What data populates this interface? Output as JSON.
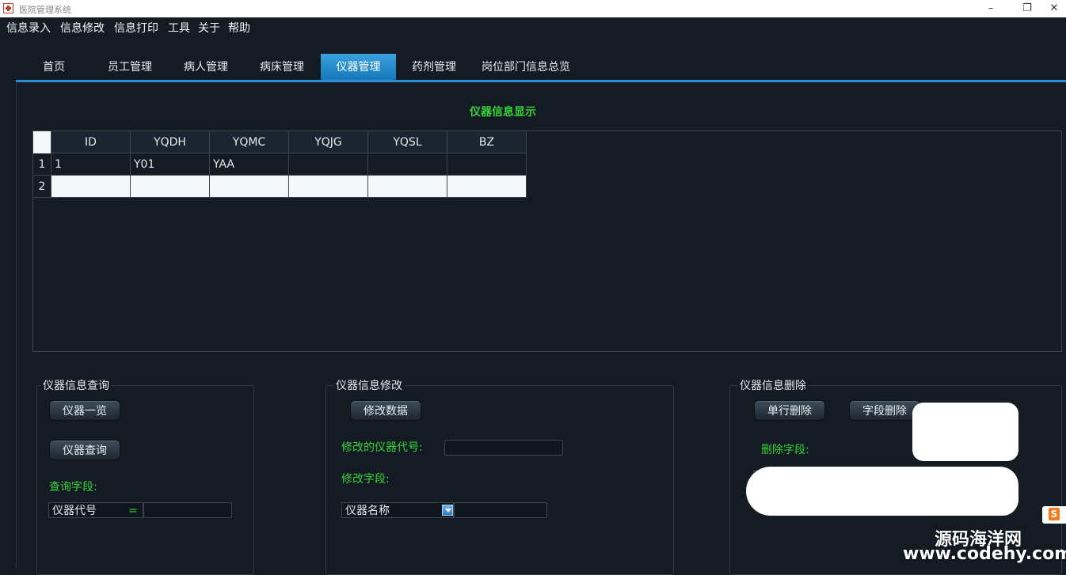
{
  "window": {
    "title": "医院管理系统",
    "minimize": "–",
    "restore": "❐",
    "close": "✕"
  },
  "menu": [
    "信息录入",
    "信息修改",
    "信息打印",
    "工具",
    "关于",
    "帮助"
  ],
  "tabs": [
    "首页",
    "员工管理",
    "病人管理",
    "病床管理",
    "仪器管理",
    "药剂管理",
    "岗位部门信息总览"
  ],
  "active_tab": "仪器管理",
  "section_title": "仪器信息显示",
  "table": {
    "columns": [
      "ID",
      "YQDH",
      "YQMC",
      "YQJG",
      "YQSL",
      "BZ"
    ],
    "rows": [
      {
        "num": "1",
        "cells": [
          "1",
          "Y01",
          "YAA",
          "",
          "",
          ""
        ]
      },
      {
        "num": "2",
        "cells": [
          "",
          "",
          "",
          "",
          "",
          ""
        ]
      }
    ]
  },
  "query": {
    "title": "仪器信息查询",
    "list_button": "仪器一览",
    "query_button": "仪器查询",
    "field_label": "查询字段:",
    "field_combo": "仪器代号",
    "operator": "=",
    "value": ""
  },
  "modify": {
    "title": "仪器信息修改",
    "button": "修改数据",
    "code_label": "修改的仪器代号:",
    "code_value": "",
    "field_label": "修改字段:",
    "field_combo": "仪器名称",
    "value": ""
  },
  "delete": {
    "title": "仪器信息删除",
    "row_button": "单行删除",
    "field_button": "字段删除",
    "field_label": "删除字段:"
  },
  "watermark": {
    "line1": "源码海洋网",
    "line2": "www.codehy.com",
    "ime_icon": "S"
  },
  "colors": {
    "background": "#141b23",
    "accent": "#2a8fd2",
    "label_green": "#38d23a"
  }
}
